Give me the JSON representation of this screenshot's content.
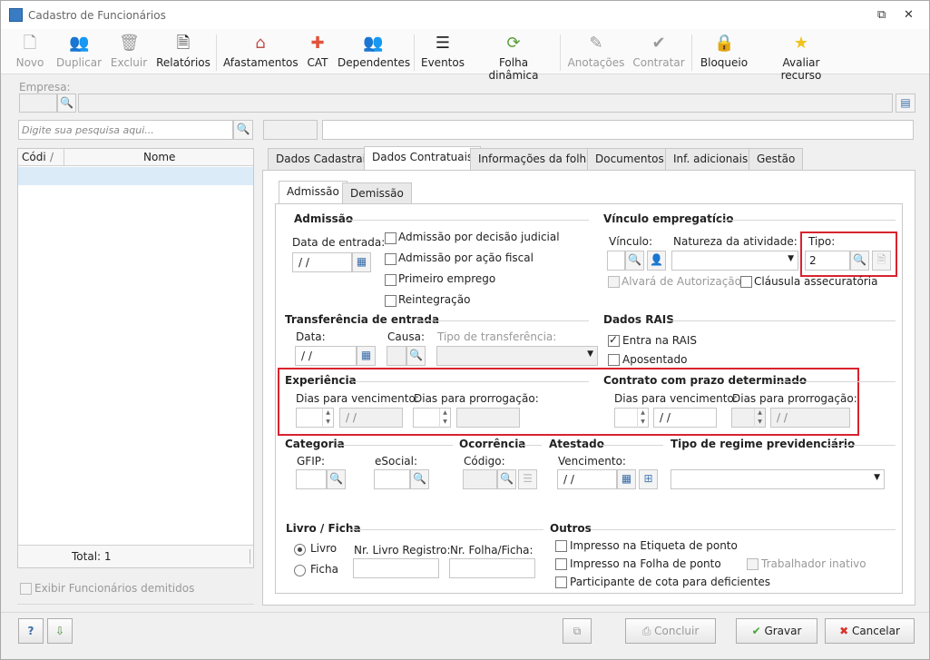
{
  "window": {
    "title": "Cadastro de Funcionários"
  },
  "toolbar": {
    "novo": "Novo",
    "duplicar": "Duplicar",
    "excluir": "Excluir",
    "relatorios": "Relatórios",
    "afastamentos": "Afastamentos",
    "cat": "CAT",
    "dependentes": "Dependentes",
    "eventos": "Eventos",
    "folha": "Folha dinâmica",
    "anotacoes": "Anotações",
    "contratar": "Contratar",
    "bloqueio": "Bloqueio",
    "avaliar": "Avaliar recurso"
  },
  "empresa": {
    "label": "Empresa:"
  },
  "search": {
    "placeholder": "Digite sua pesquisa aqui..."
  },
  "grid": {
    "col_code": "Códi",
    "col_sort": "/",
    "col_name": "Nome",
    "total": "Total: 1"
  },
  "exibir_demitidos": "Exibir Funcionários demitidos",
  "tabs": [
    "Dados Cadastrais",
    "Dados Contratuais",
    "Informações da folha",
    "Documentos",
    "Inf. adicionais",
    "Gestão"
  ],
  "subtabs": [
    "Admissão",
    "Demissão"
  ],
  "admissao": {
    "title": "Admissão",
    "data_entrada": "Data de entrada:",
    "data_value": " /  /",
    "chk1": "Admissão por decisão judicial",
    "chk2": "Admissão por ação fiscal",
    "chk3": "Primeiro emprego",
    "chk4": "Reintegração"
  },
  "vinculo": {
    "title": "Vínculo empregatício",
    "vinculo": "Vínculo:",
    "natureza": "Natureza da atividade:",
    "tipo": "Tipo:",
    "tipo_value": "2",
    "alvara": "Alvará de Autorização",
    "clausula": "Cláusula assecuratória"
  },
  "transferencia": {
    "title": "Transferência de entrada",
    "data": "Data:",
    "data_value": " /  /",
    "causa": "Causa:",
    "tipo": "Tipo de transferência:"
  },
  "rais": {
    "title": "Dados RAIS",
    "entra": "Entra na RAIS",
    "aposentado": "Aposentado"
  },
  "experiencia": {
    "title": "Experiência",
    "dias_venc": "Dias para vencimento:",
    "dias_prorr": "Dias para prorrogação:",
    "date": " /  /"
  },
  "contrato": {
    "title": "Contrato com prazo determinado",
    "dias_venc": "Dias para vencimento:",
    "dias_prorr": "Dias para prorrogação:",
    "date": " /  /"
  },
  "categoria": {
    "title": "Categoria",
    "gfip": "GFIP:",
    "esocial": "eSocial:"
  },
  "ocorrencia": {
    "title": "Ocorrência",
    "codigo": "Código:"
  },
  "atestado": {
    "title": "Atestado",
    "vencimento": "Vencimento:",
    "date": " /  /"
  },
  "regime": {
    "title": "Tipo de regime previdenciário"
  },
  "livro": {
    "title": "Livro / Ficha",
    "livro": "Livro",
    "ficha": "Ficha",
    "nr_livro": "Nr. Livro Registro:",
    "nr_folha": "Nr. Folha/Ficha:"
  },
  "outros": {
    "title": "Outros",
    "etiqueta": "Impresso na Etiqueta de ponto",
    "folha": "Impresso na Folha de ponto",
    "inativo": "Trabalhador inativo",
    "cota": "Participante de cota para deficientes"
  },
  "buttons": {
    "concluir": "Concluir",
    "gravar": "Gravar",
    "cancelar": "Cancelar"
  },
  "colors": {
    "accent": "#3a6da8",
    "highlight": "#d9232e",
    "selection": "#dcebf8"
  }
}
